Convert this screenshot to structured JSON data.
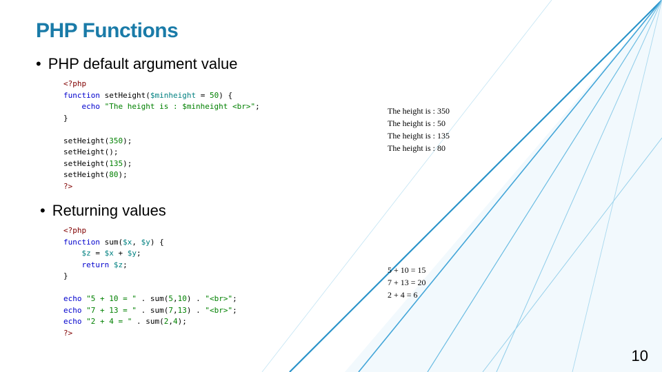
{
  "title": "PHP Functions",
  "bullets": {
    "b1": "PHP default argument value",
    "b2": "Returning values"
  },
  "code1": {
    "l1_open": "<?php",
    "l2_func": "function",
    "l2_name": " setHeight(",
    "l2_var": "$minheight",
    "l2_eq": " = ",
    "l2_num": "50",
    "l2_close": ") {",
    "l3_echo": "    echo",
    "l3_str": " \"The height is : $minheight <br>\"",
    "l3_semi": ";",
    "l4": "}",
    "l5": "",
    "l6": "setHeight(",
    "l6n": "350",
    "l6e": ");",
    "l7": "setHeight();",
    "l8": "setHeight(",
    "l8n": "135",
    "l8e": ");",
    "l9": "setHeight(",
    "l9n": "80",
    "l9e": ");",
    "l10": "?>"
  },
  "output1": {
    "o1": "The height is : 350",
    "o2": "The height is : 50",
    "o3": "The height is : 135",
    "o4": "The height is : 80"
  },
  "code2": {
    "l1_open": "<?php",
    "l2_func": "function",
    "l2_name": " sum(",
    "l2_v1": "$x",
    "l2_c": ", ",
    "l2_v2": "$y",
    "l2_close": ") {",
    "l3a": "    ",
    "l3v": "$z",
    "l3e": " = ",
    "l3x": "$x",
    "l3p": " + ",
    "l3y": "$y",
    "l3s": ";",
    "l4r": "    return",
    "l4v": " $z",
    "l4s": ";",
    "l5": "}",
    "l6": "",
    "l7e": "echo",
    "l7s1": " \"5 + 10 = \"",
    "l7d1": " . sum(",
    "l7n1": "5",
    "l7cm": ",",
    "l7n2": "10",
    "l7cp": ") . ",
    "l7s2": "\"<br>\"",
    "l7se": ";",
    "l8e": "echo",
    "l8s1": " \"7 + 13 = \"",
    "l8d1": " . sum(",
    "l8n1": "7",
    "l8cm": ",",
    "l8n2": "13",
    "l8cp": ") . ",
    "l8s2": "\"<br>\"",
    "l8se": ";",
    "l9e": "echo",
    "l9s1": " \"2 + 4 = \"",
    "l9d1": " . sum(",
    "l9n1": "2",
    "l9cm": ",",
    "l9n2": "4",
    "l9cp": ");",
    "l10": "?>"
  },
  "output2": {
    "o1": "5 + 10 = 15",
    "o2": "7 + 13 = 20",
    "o3": "2 + 4 = 6"
  },
  "pageNumber": "10"
}
